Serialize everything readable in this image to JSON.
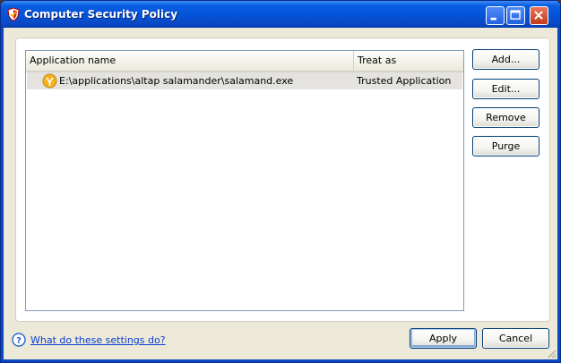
{
  "window": {
    "title": "Computer Security Policy",
    "accent_color": "#0453d8",
    "icon": "shield-app-icon",
    "controls": {
      "minimize_icon": "minimize-icon",
      "maximize_icon": "maximize-icon",
      "close_icon": "close-icon"
    }
  },
  "list": {
    "columns": [
      "Application name",
      "Treat as"
    ],
    "rows": [
      {
        "icon": "salamander-app-icon",
        "name": "E:\\applications\\altap salamander\\salamand.exe",
        "treat_as": "Trusted Application"
      }
    ]
  },
  "side_buttons": {
    "add": "Add...",
    "edit": "Edit...",
    "remove": "Remove",
    "purge": "Purge"
  },
  "footer": {
    "help_icon": "help-icon",
    "help_link": "What do these settings do?",
    "apply": "Apply",
    "cancel": "Cancel"
  }
}
